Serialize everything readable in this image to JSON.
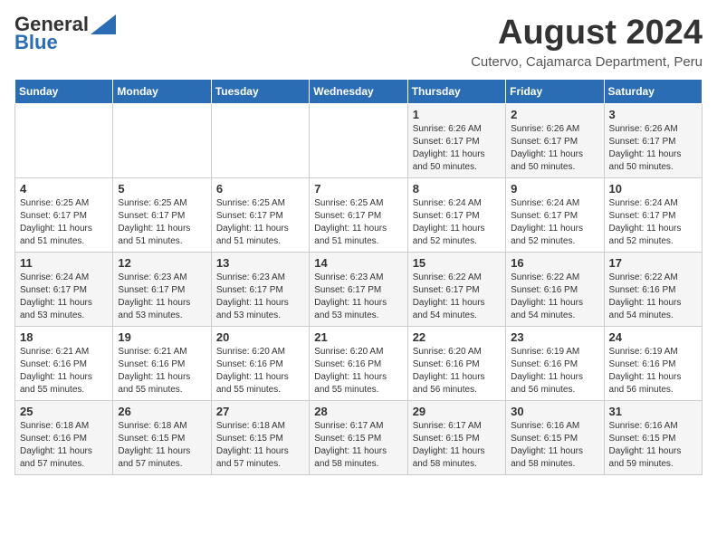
{
  "logo": {
    "general": "General",
    "blue": "Blue"
  },
  "title": "August 2024",
  "subtitle": "Cutervo, Cajamarca Department, Peru",
  "days_of_week": [
    "Sunday",
    "Monday",
    "Tuesday",
    "Wednesday",
    "Thursday",
    "Friday",
    "Saturday"
  ],
  "weeks": [
    [
      {
        "day": "",
        "info": ""
      },
      {
        "day": "",
        "info": ""
      },
      {
        "day": "",
        "info": ""
      },
      {
        "day": "",
        "info": ""
      },
      {
        "day": "1",
        "info": "Sunrise: 6:26 AM\nSunset: 6:17 PM\nDaylight: 11 hours\nand 50 minutes."
      },
      {
        "day": "2",
        "info": "Sunrise: 6:26 AM\nSunset: 6:17 PM\nDaylight: 11 hours\nand 50 minutes."
      },
      {
        "day": "3",
        "info": "Sunrise: 6:26 AM\nSunset: 6:17 PM\nDaylight: 11 hours\nand 50 minutes."
      }
    ],
    [
      {
        "day": "4",
        "info": "Sunrise: 6:25 AM\nSunset: 6:17 PM\nDaylight: 11 hours\nand 51 minutes."
      },
      {
        "day": "5",
        "info": "Sunrise: 6:25 AM\nSunset: 6:17 PM\nDaylight: 11 hours\nand 51 minutes."
      },
      {
        "day": "6",
        "info": "Sunrise: 6:25 AM\nSunset: 6:17 PM\nDaylight: 11 hours\nand 51 minutes."
      },
      {
        "day": "7",
        "info": "Sunrise: 6:25 AM\nSunset: 6:17 PM\nDaylight: 11 hours\nand 51 minutes."
      },
      {
        "day": "8",
        "info": "Sunrise: 6:24 AM\nSunset: 6:17 PM\nDaylight: 11 hours\nand 52 minutes."
      },
      {
        "day": "9",
        "info": "Sunrise: 6:24 AM\nSunset: 6:17 PM\nDaylight: 11 hours\nand 52 minutes."
      },
      {
        "day": "10",
        "info": "Sunrise: 6:24 AM\nSunset: 6:17 PM\nDaylight: 11 hours\nand 52 minutes."
      }
    ],
    [
      {
        "day": "11",
        "info": "Sunrise: 6:24 AM\nSunset: 6:17 PM\nDaylight: 11 hours\nand 53 minutes."
      },
      {
        "day": "12",
        "info": "Sunrise: 6:23 AM\nSunset: 6:17 PM\nDaylight: 11 hours\nand 53 minutes."
      },
      {
        "day": "13",
        "info": "Sunrise: 6:23 AM\nSunset: 6:17 PM\nDaylight: 11 hours\nand 53 minutes."
      },
      {
        "day": "14",
        "info": "Sunrise: 6:23 AM\nSunset: 6:17 PM\nDaylight: 11 hours\nand 53 minutes."
      },
      {
        "day": "15",
        "info": "Sunrise: 6:22 AM\nSunset: 6:17 PM\nDaylight: 11 hours\nand 54 minutes."
      },
      {
        "day": "16",
        "info": "Sunrise: 6:22 AM\nSunset: 6:16 PM\nDaylight: 11 hours\nand 54 minutes."
      },
      {
        "day": "17",
        "info": "Sunrise: 6:22 AM\nSunset: 6:16 PM\nDaylight: 11 hours\nand 54 minutes."
      }
    ],
    [
      {
        "day": "18",
        "info": "Sunrise: 6:21 AM\nSunset: 6:16 PM\nDaylight: 11 hours\nand 55 minutes."
      },
      {
        "day": "19",
        "info": "Sunrise: 6:21 AM\nSunset: 6:16 PM\nDaylight: 11 hours\nand 55 minutes."
      },
      {
        "day": "20",
        "info": "Sunrise: 6:20 AM\nSunset: 6:16 PM\nDaylight: 11 hours\nand 55 minutes."
      },
      {
        "day": "21",
        "info": "Sunrise: 6:20 AM\nSunset: 6:16 PM\nDaylight: 11 hours\nand 55 minutes."
      },
      {
        "day": "22",
        "info": "Sunrise: 6:20 AM\nSunset: 6:16 PM\nDaylight: 11 hours\nand 56 minutes."
      },
      {
        "day": "23",
        "info": "Sunrise: 6:19 AM\nSunset: 6:16 PM\nDaylight: 11 hours\nand 56 minutes."
      },
      {
        "day": "24",
        "info": "Sunrise: 6:19 AM\nSunset: 6:16 PM\nDaylight: 11 hours\nand 56 minutes."
      }
    ],
    [
      {
        "day": "25",
        "info": "Sunrise: 6:18 AM\nSunset: 6:16 PM\nDaylight: 11 hours\nand 57 minutes."
      },
      {
        "day": "26",
        "info": "Sunrise: 6:18 AM\nSunset: 6:15 PM\nDaylight: 11 hours\nand 57 minutes."
      },
      {
        "day": "27",
        "info": "Sunrise: 6:18 AM\nSunset: 6:15 PM\nDaylight: 11 hours\nand 57 minutes."
      },
      {
        "day": "28",
        "info": "Sunrise: 6:17 AM\nSunset: 6:15 PM\nDaylight: 11 hours\nand 58 minutes."
      },
      {
        "day": "29",
        "info": "Sunrise: 6:17 AM\nSunset: 6:15 PM\nDaylight: 11 hours\nand 58 minutes."
      },
      {
        "day": "30",
        "info": "Sunrise: 6:16 AM\nSunset: 6:15 PM\nDaylight: 11 hours\nand 58 minutes."
      },
      {
        "day": "31",
        "info": "Sunrise: 6:16 AM\nSunset: 6:15 PM\nDaylight: 11 hours\nand 59 minutes."
      }
    ]
  ]
}
